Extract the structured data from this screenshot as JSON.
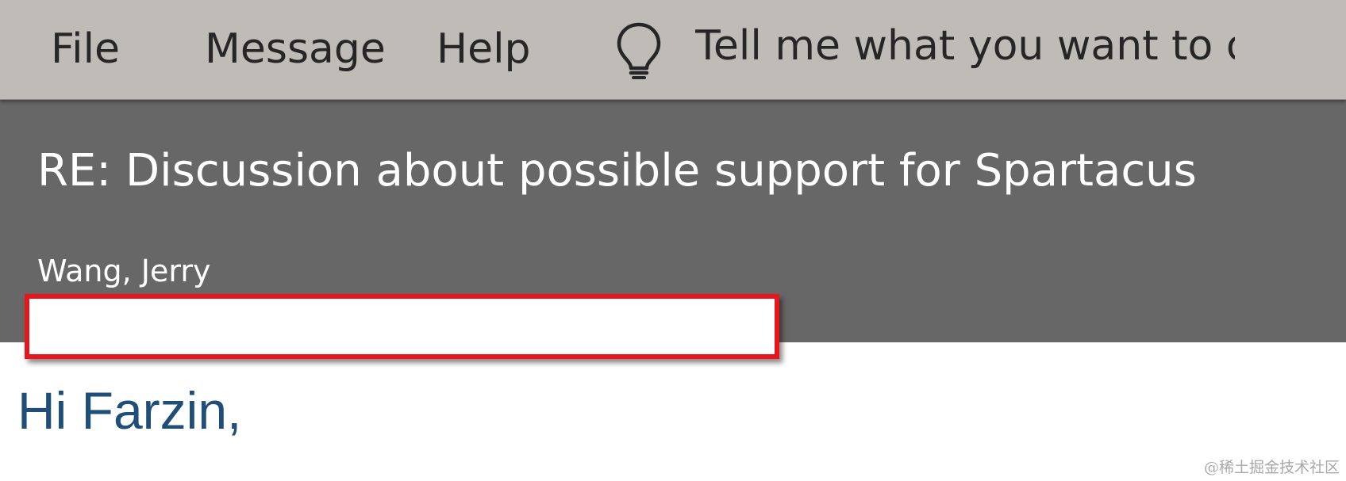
{
  "ribbon": {
    "menu": {
      "file": "File",
      "message": "Message",
      "help": "Help"
    },
    "tell_me_icon": "lightbulb-icon",
    "tell_me_text": "Tell me what you want to do"
  },
  "message": {
    "subject": "RE: Discussion about possible support for Spartacus",
    "sender": "Wang, Jerry"
  },
  "body": {
    "greeting": "Hi Farzin,"
  },
  "watermark": "@稀土掘金技术社区",
  "colors": {
    "ribbon_bg": "#bfbcb8",
    "header_bg": "#676767",
    "redaction_border": "#e8151b",
    "greeting_text": "#1f4e79"
  }
}
